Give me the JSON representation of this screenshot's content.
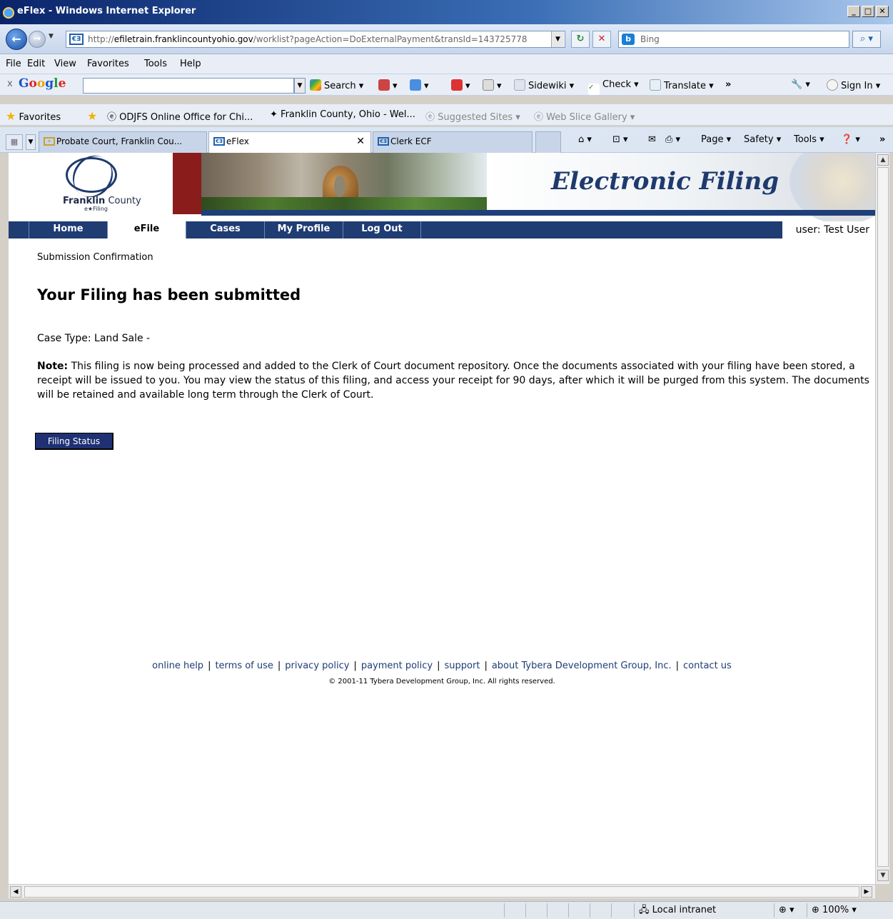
{
  "window": {
    "title": "eFlex - Windows Internet Explorer"
  },
  "address": {
    "scheme": "http://",
    "host": "efiletrain.franklincountyohio.gov",
    "path": "/worklist?pageAction=DoExternalPayment&transId=143725778",
    "search_placeholder": "Bing"
  },
  "menubar": [
    "File",
    "Edit",
    "View",
    "Favorites",
    "Tools",
    "Help"
  ],
  "google_toolbar": {
    "search_label": "Search",
    "sidewiki_label": "Sidewiki",
    "check_label": "Check",
    "translate_label": "Translate",
    "more_label": "»",
    "signin_label": "Sign In"
  },
  "favorites_bar": {
    "favorites_label": "Favorites",
    "items": [
      "ODJFS Online  Office for Chi...",
      "Franklin County, Ohio - Wel...",
      "Suggested Sites",
      "Web Slice Gallery"
    ]
  },
  "tabs": [
    {
      "label": "Probate Court, Franklin Cou..."
    },
    {
      "label": "eFlex"
    },
    {
      "label": "Clerk ECF"
    }
  ],
  "command_bar": {
    "page": "Page",
    "safety": "Safety",
    "tools": "Tools",
    "more": "»"
  },
  "site": {
    "logo_name_bold": "Franklin",
    "logo_name_rest": " County",
    "logo_sub": "e★Filing",
    "banner_title": "Electronic Filing",
    "nav": [
      "Home",
      "eFile",
      "Cases",
      "My Profile",
      "Log Out"
    ],
    "user_label": "user: Test User"
  },
  "main": {
    "page_label": "Submission Confirmation",
    "heading": "Your Filing has been submitted",
    "case_type": "Case Type: Land Sale -",
    "note_label": "Note:",
    "note_text": " This filing is now being processed and added to the Clerk of Court document repository. Once the documents associated with your filing have been stored, a receipt will be issued to you. You may view the status of this filing, and access your receipt for 90 days, after which it will be purged from this system. The documents will be retained and available long term through the Clerk of Court.",
    "filing_status_button": "Filing Status"
  },
  "footer": {
    "links": [
      "online help",
      "terms of use",
      "privacy policy",
      "payment policy",
      "support",
      "about Tybera Development Group, Inc.",
      "contact us"
    ],
    "copyright": "© 2001-11 Tybera Development Group, Inc. All rights reserved."
  },
  "statusbar": {
    "zone": "Local intranet",
    "zoom": "100%"
  },
  "colors": {
    "site_nav": "#1f3c73",
    "banner_red": "#8b1c1c",
    "link": "#1f3c73"
  }
}
